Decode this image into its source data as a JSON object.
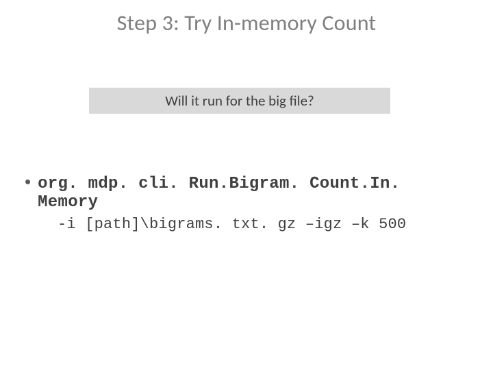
{
  "title": "Step 3: Try In-memory Count",
  "question": "Will it run for the big file?",
  "bullet": {
    "dot": "•",
    "command": "org. mdp. cli. Run.Bigram. Count.In. Memory",
    "args": "-i [path]\\bigrams. txt. gz –igz –k 500"
  }
}
